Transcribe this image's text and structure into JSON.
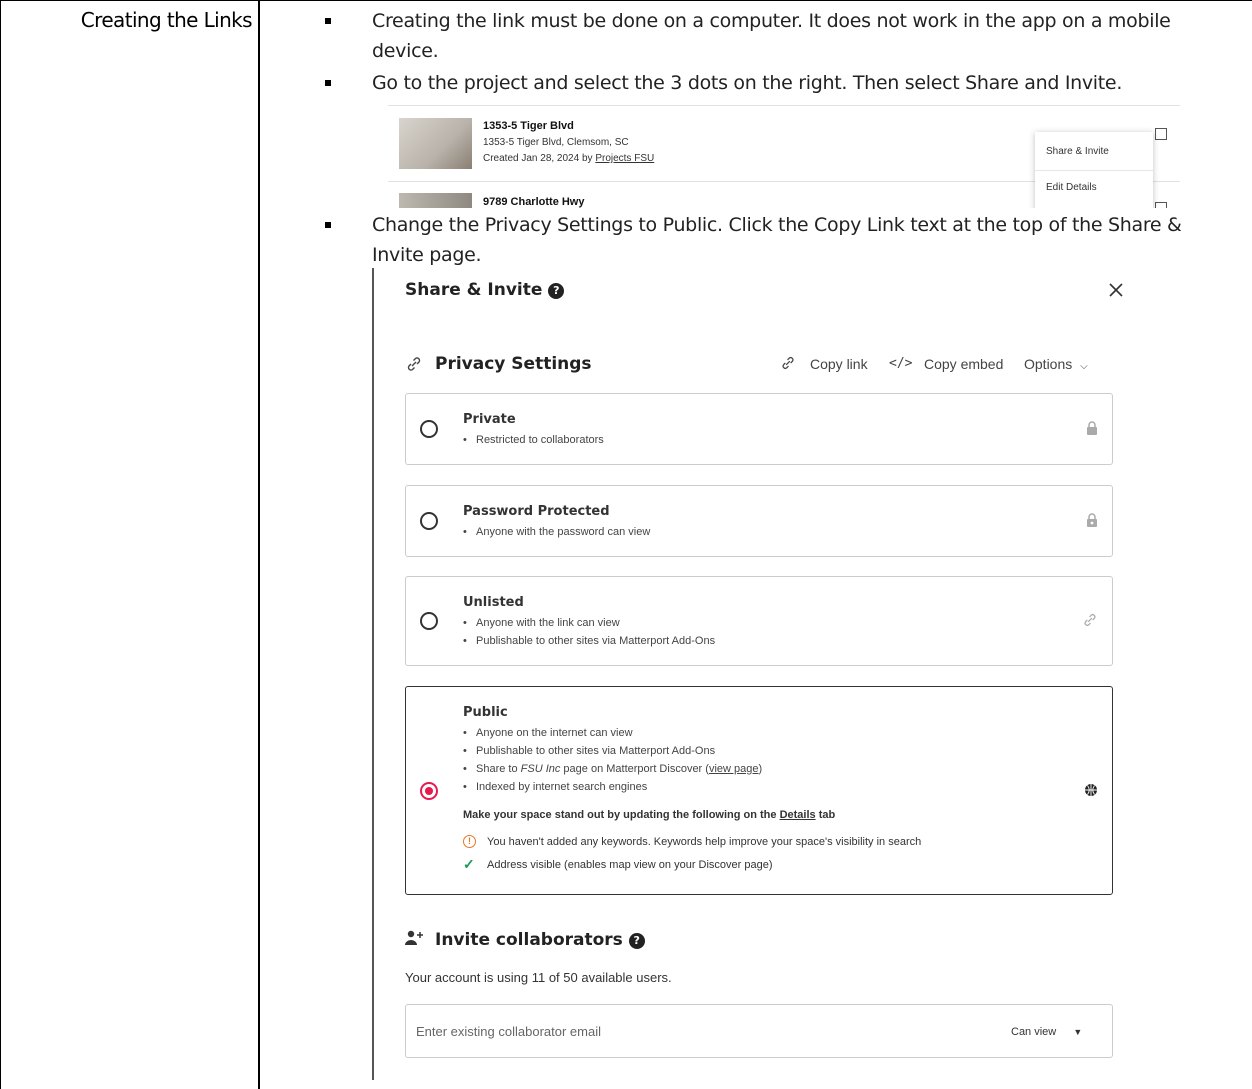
{
  "doc": {
    "section_label": "Creating the Links",
    "bullets": [
      "Creating the link must be done on a computer. It does not work in the app on a mobile",
      "device.",
      "Go to the project and select the 3 dots on the right. Then select Share and Invite.",
      "Change the Privacy Settings to Public. Click the Copy Link text at the top of the Share &",
      "Invite page."
    ]
  },
  "projects": {
    "item1_title": "1353-5 Tiger Blvd",
    "item1_address": "1353-5 Tiger Blvd, Clemsom, SC",
    "item1_created": "Created Jan 28, 2024 by",
    "item1_creator": "Projects FSU",
    "item2_title": "9789 Charlotte Hwy",
    "menu_share": "Share & Invite",
    "menu_edit": "Edit Details"
  },
  "share": {
    "title": "Share & Invite",
    "privacy_title": "Privacy Settings",
    "copy_link": "Copy link",
    "copy_embed": "Copy embed",
    "options": "Options",
    "private_name": "Private",
    "private_b1": "Restricted to collaborators",
    "password_name": "Password Protected",
    "password_b1": "Anyone with the password can view",
    "unlisted_name": "Unlisted",
    "unlisted_b1": "Anyone with the link can view",
    "unlisted_b2": "Publishable to other sites via Matterport Add-Ons",
    "public_name": "Public",
    "public_b1": "Anyone on the internet can view",
    "public_b2": "Publishable to other sites via Matterport Add-Ons",
    "public_b3_pre": "Share to ",
    "public_b3_org": "FSU Inc",
    "public_b3_mid": " page on Matterport Discover (",
    "public_b3_link": "view page",
    "public_b3_post": ")",
    "public_b4": "Indexed by internet search engines",
    "standout_pre": "Make your space stand out by updating the following on the ",
    "standout_link": "Details",
    "standout_post": " tab",
    "warn_keywords": "You haven't added any keywords. Keywords help improve your space's visibility in search",
    "ok_address": "Address visible (enables map view on your Discover page)",
    "invite_title": "Invite collaborators",
    "account_usage": "Your account is using 11 of 50 available users.",
    "email_placeholder": "Enter existing collaborator email",
    "permission": "Can view"
  }
}
